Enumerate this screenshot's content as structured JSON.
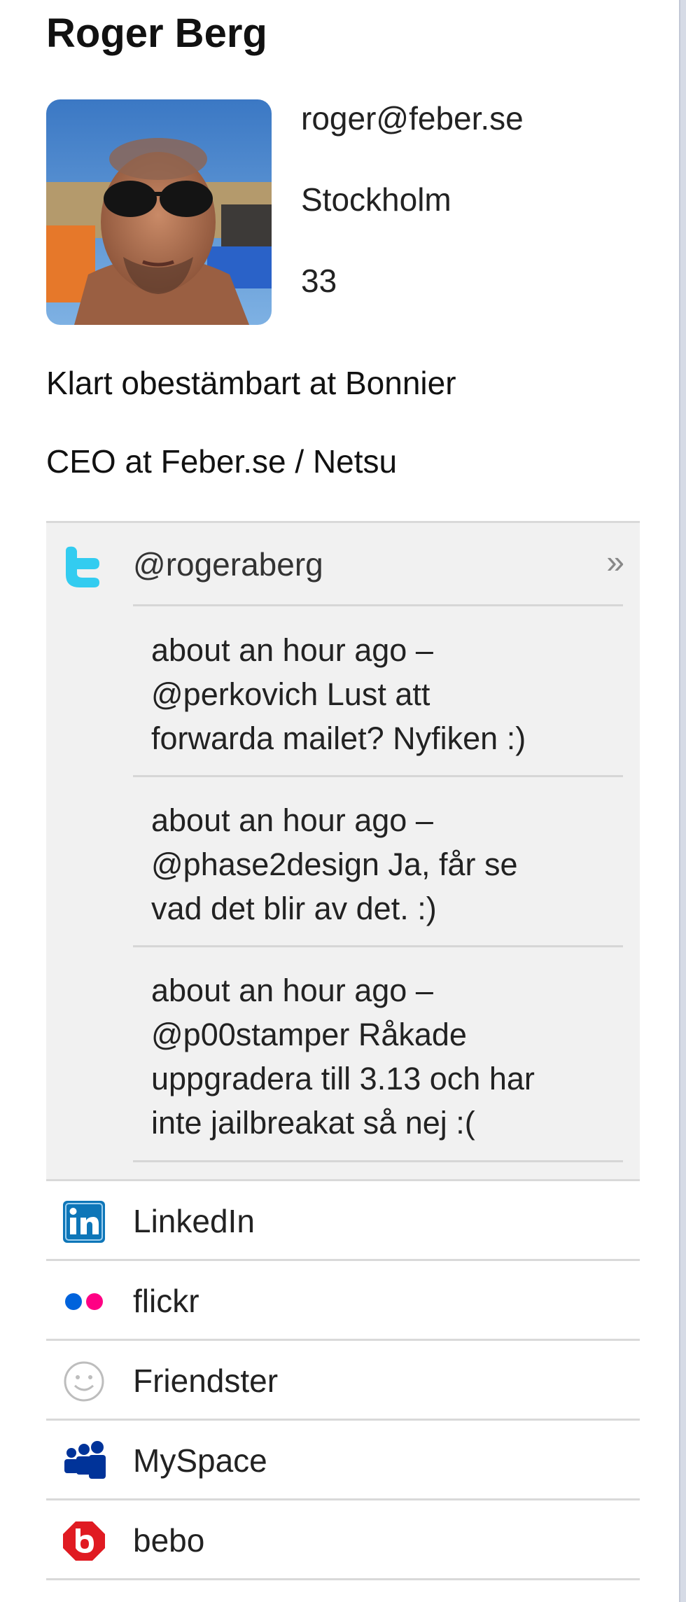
{
  "profile": {
    "name": "Roger Berg",
    "email": "roger@feber.se",
    "city": "Stockholm",
    "age": "33",
    "line1": "Klart obestämbart at Bonnier",
    "line2": "CEO at Feber.se / Netsu"
  },
  "twitter": {
    "icon": "twitter-icon",
    "handle": "@rogeraberg",
    "more": "»",
    "tweets": [
      {
        "lines": [
          "about an hour ago –",
          "@perkovich Lust att",
          "forwarda mailet? Nyfiken :)"
        ]
      },
      {
        "lines": [
          "about an hour ago –",
          "@phase2design Ja, får se",
          "vad det blir av det. :)"
        ]
      },
      {
        "lines": [
          "about an hour ago –",
          "@p00stamper Råkade",
          "uppgradera till 3.13 och har",
          "inte jailbreakat så nej :("
        ]
      }
    ]
  },
  "social": [
    {
      "label": "LinkedIn",
      "icon": "linkedin-icon"
    },
    {
      "label": "flickr",
      "icon": "flickr-icon"
    },
    {
      "label": "Friendster",
      "icon": "friendster-icon"
    },
    {
      "label": "MySpace",
      "icon": "myspace-icon"
    },
    {
      "label": "bebo",
      "icon": "bebo-icon"
    }
  ],
  "colors": {
    "twitter": "#33ccf0",
    "linkedin": "#0e76b8",
    "flickr_blue": "#0063dc",
    "flickr_pink": "#ff0084",
    "myspace": "#003399",
    "bebo": "#e01b22",
    "panel_bg": "#f1f1f1",
    "divider": "#d9d9d9"
  }
}
